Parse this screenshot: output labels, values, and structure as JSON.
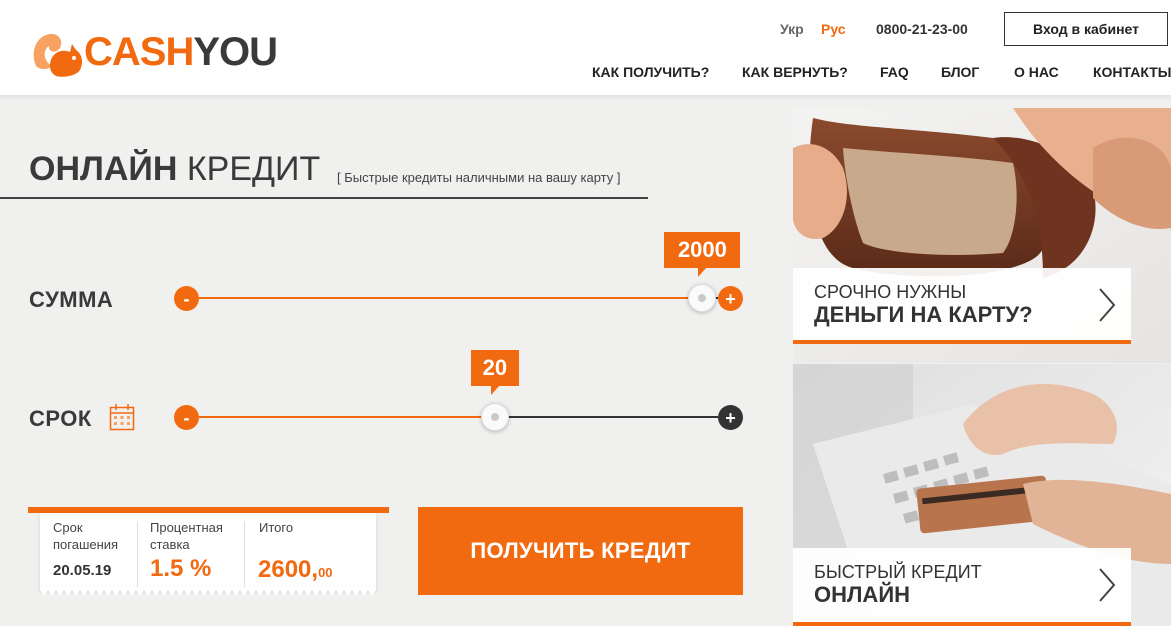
{
  "brand": {
    "part1": "CASH",
    "part2": "YOU"
  },
  "header": {
    "lang_uk": "Укр",
    "lang_ru": "Рус",
    "phone": "0800-21-23-00",
    "cabinet_button": "Вход в кабинет",
    "nav": [
      {
        "label": "КАК ПОЛУЧИТЬ?"
      },
      {
        "label": "КАК ВЕРНУТЬ?"
      },
      {
        "label": "FAQ"
      },
      {
        "label": "БЛОГ"
      },
      {
        "label": "О НАС"
      },
      {
        "label": "КОНТАКТЫ"
      }
    ]
  },
  "hero": {
    "title_bold": "ОНЛАЙН",
    "title_light": "КРЕДИТ",
    "subtitle": "[ Быстрые кредиты наличными на вашу карту ]"
  },
  "amount": {
    "label": "СУММА",
    "value": "2000",
    "minus": "-",
    "plus": "+",
    "fill_fraction": 0.97
  },
  "term": {
    "label": "СРОК",
    "value": "20",
    "minus": "-",
    "plus": "+",
    "fill_fraction": 0.57
  },
  "receipt": {
    "due_label_1": "Срок",
    "due_label_2": "погашения",
    "due_value": "20.05.19",
    "rate_label_1": "Процентная",
    "rate_label_2": "ставка",
    "rate_value": "1.5 %",
    "total_label": "Итого",
    "total_main": "2600,",
    "total_cents": "00"
  },
  "cta": {
    "label": "ПОЛУЧИТЬ КРЕДИТ"
  },
  "cards": [
    {
      "line1": "СРОЧНО НУЖНЫ",
      "line2": "ДЕНЬГИ НА КАРТУ?",
      "icon": "chevron-right-icon"
    },
    {
      "line1": "БЫСТРЫЙ КРЕДИТ",
      "line2": "ОНЛАЙН",
      "icon": "chevron-right-icon"
    }
  ],
  "colors": {
    "accent": "#f26a10",
    "dark": "#333333",
    "background": "#f0f0ef"
  }
}
